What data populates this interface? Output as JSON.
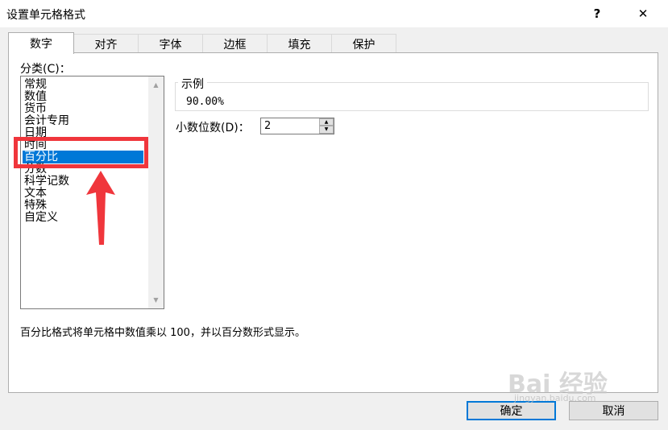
{
  "window": {
    "title": "设置单元格格式",
    "help_label": "?",
    "close_label": "✕"
  },
  "tabs": [
    "数字",
    "对齐",
    "字体",
    "边框",
    "填充",
    "保护"
  ],
  "category": {
    "label": "分类(C)：",
    "items": [
      "常规",
      "数值",
      "货币",
      "会计专用",
      "日期",
      "时间",
      "百分比",
      "分数",
      "科学记数",
      "文本",
      "特殊",
      "自定义"
    ],
    "selected": "百分比"
  },
  "sample": {
    "legend": "示例",
    "value": "90.00%"
  },
  "decimal_places": {
    "label": "小数位数(D)：",
    "value": "2"
  },
  "description": "百分比格式将单元格中数值乘以 100，并以百分数形式显示。",
  "buttons": {
    "ok": "确定",
    "cancel": "取消"
  },
  "annotation": {
    "highlight_color": "#f0363c",
    "selection_color": "#0078d7"
  },
  "watermark": {
    "brand": "Bai 经验",
    "url": "jingyan.baidu.com"
  }
}
